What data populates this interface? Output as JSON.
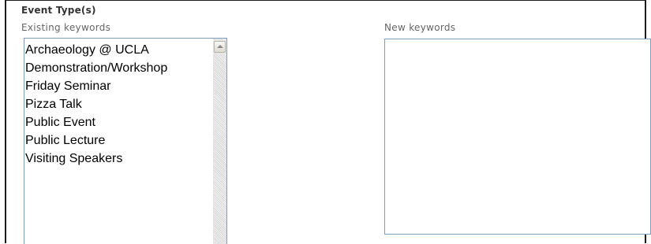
{
  "section": {
    "title": "Event Type(s)"
  },
  "existing_keywords": {
    "label": "Existing keywords",
    "options": [
      "Archaeology @ UCLA",
      "Demonstration/Workshop",
      "Friday Seminar",
      "Pizza Talk",
      "Public Event",
      "Public Lecture",
      "Visiting Speakers"
    ]
  },
  "new_keywords": {
    "label": "New keywords",
    "value": ""
  },
  "icons": {
    "scroll_up": "scroll-up-arrow-icon"
  }
}
